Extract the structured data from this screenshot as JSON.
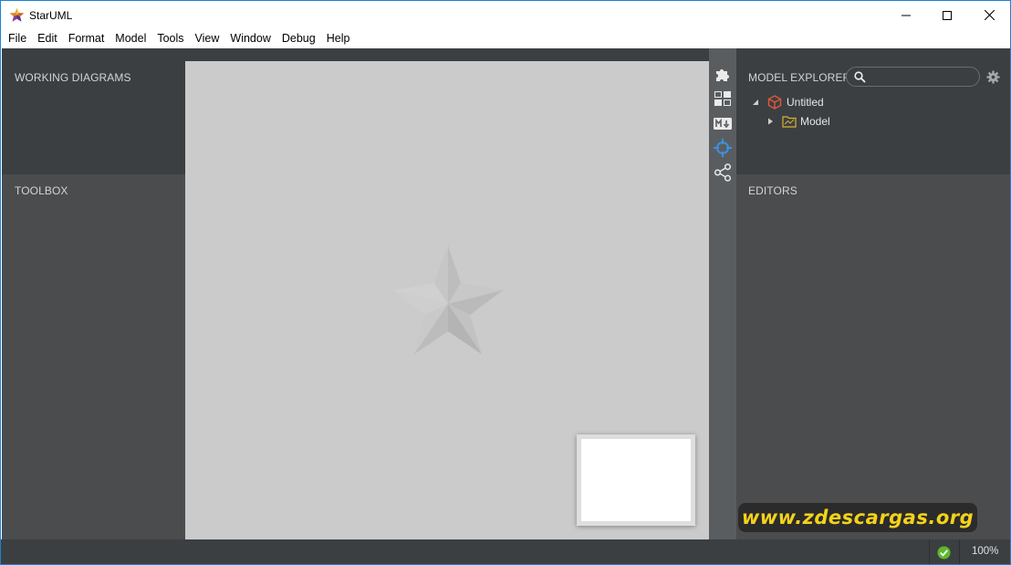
{
  "window": {
    "title": "StarUML"
  },
  "menu": [
    "File",
    "Edit",
    "Format",
    "Model",
    "Tools",
    "View",
    "Window",
    "Debug",
    "Help"
  ],
  "panels": {
    "working_diagrams": "WORKING DIAGRAMS",
    "toolbox": "TOOLBOX",
    "model_explorer": "MODEL EXPLORER",
    "editors": "EDITORS"
  },
  "search": {
    "placeholder": ""
  },
  "tree": {
    "root": "Untitled",
    "child": "Model"
  },
  "toolstrip_icons": [
    "puzzle-icon",
    "diagram-layout-icon",
    "markdown-icon",
    "crosshair-icon",
    "share-icon"
  ],
  "status": {
    "zoom": "100%"
  },
  "watermark": "www.zdescargas.org",
  "colors": {
    "accent_blue": "#1883d7",
    "panel_dark": "#3c3f41",
    "panel_mid": "#4a4c4e",
    "canvas": "#cbcbcb",
    "tree_root_icon": "#e2573c",
    "tree_folder_icon": "#d7b233",
    "status_ok": "#5cb82f"
  }
}
